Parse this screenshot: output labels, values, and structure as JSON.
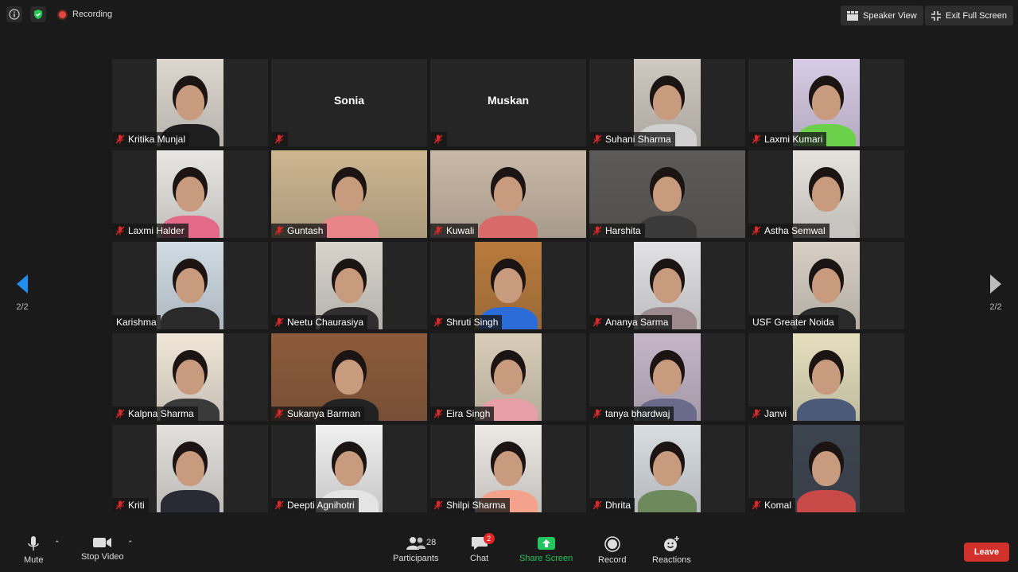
{
  "topbar": {
    "recording_label": "Recording",
    "speaker_view_label": "Speaker View",
    "exit_fullscreen_label": "Exit Full Screen"
  },
  "nav": {
    "page_left": "2/2",
    "page_right": "2/2"
  },
  "participants": [
    {
      "name": "Kritika Munjal",
      "video": true
    },
    {
      "name": "Sonia",
      "video": false
    },
    {
      "name": "Muskan",
      "video": false
    },
    {
      "name": "Suhani Sharma",
      "video": true
    },
    {
      "name": "Laxmi Kumari",
      "video": true
    },
    {
      "name": "Laxmi Halder",
      "video": true
    },
    {
      "name": "Guntash",
      "video": true
    },
    {
      "name": "Kuwali",
      "video": true
    },
    {
      "name": "Harshita",
      "video": true
    },
    {
      "name": "Astha Semwal",
      "video": true
    },
    {
      "name": "Karishma",
      "video": true
    },
    {
      "name": "Neetu Chaurasiya",
      "video": true
    },
    {
      "name": "Shruti Singh",
      "video": true
    },
    {
      "name": "Ananya Sarma",
      "video": true
    },
    {
      "name": "USF Greater Noida",
      "video": true
    },
    {
      "name": "Kalpna Sharma",
      "video": true
    },
    {
      "name": "Sukanya Barman",
      "video": true
    },
    {
      "name": "Eira Singh",
      "video": true
    },
    {
      "name": "tanya bhardwaj",
      "video": true
    },
    {
      "name": "Janvi",
      "video": true
    },
    {
      "name": "Kriti",
      "video": true
    },
    {
      "name": "Deepti Agnihotri",
      "video": true
    },
    {
      "name": "Shilpi Sharma",
      "video": true
    },
    {
      "name": "Dhrita",
      "video": true
    },
    {
      "name": "Komal",
      "video": true
    }
  ],
  "toolbar": {
    "mute_label": "Mute",
    "stop_video_label": "Stop Video",
    "participants_label": "Participants",
    "participants_count": "28",
    "chat_label": "Chat",
    "chat_badge": "2",
    "share_screen_label": "Share Screen",
    "record_label": "Record",
    "reactions_label": "Reactions",
    "leave_label": "Leave"
  },
  "colors": {
    "share_green": "#22c55e",
    "leave_red": "#d2302a",
    "muted_red": "#e02828"
  }
}
